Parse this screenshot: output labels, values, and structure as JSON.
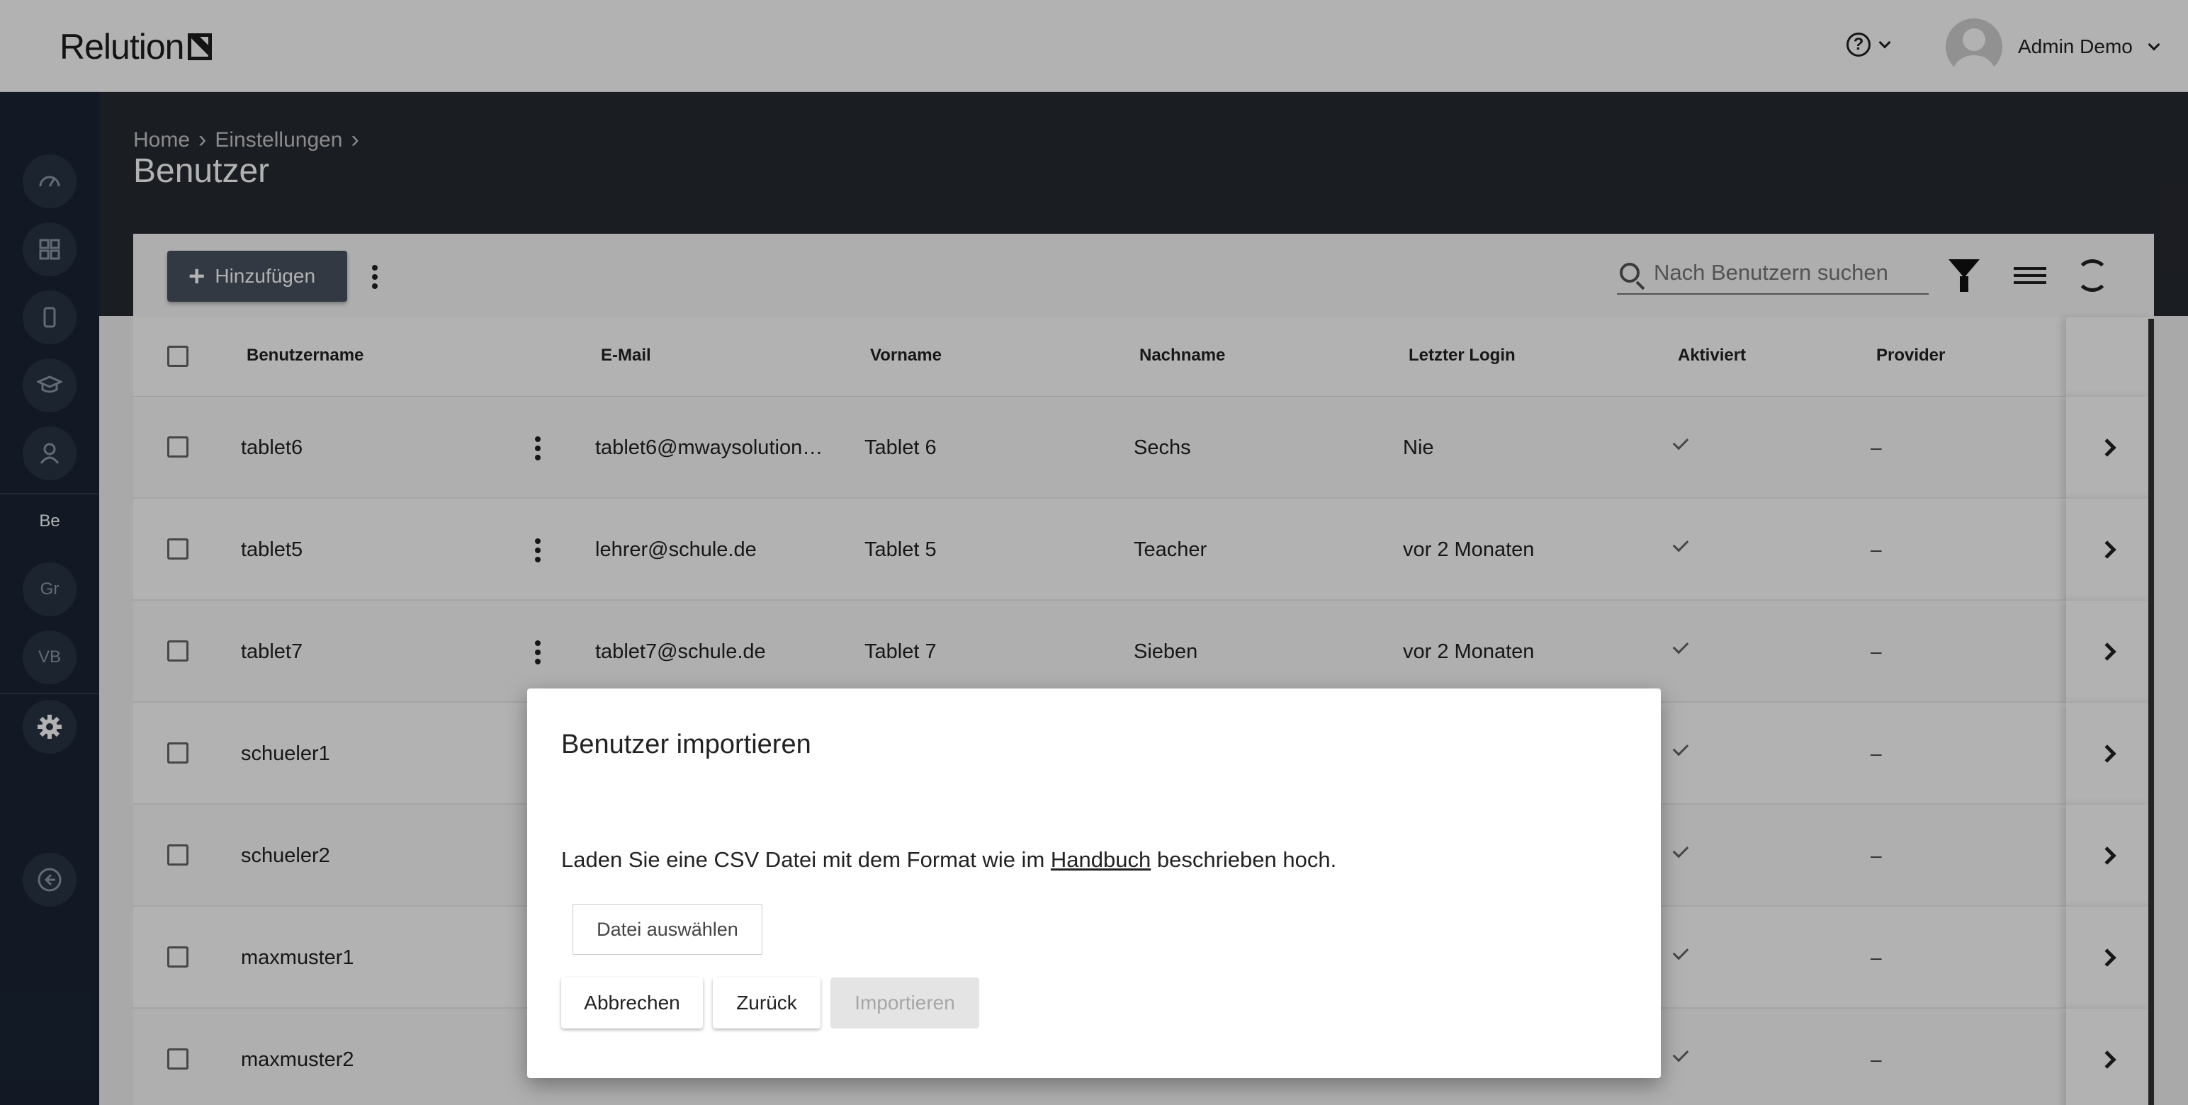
{
  "app": {
    "logo_text": "Relution"
  },
  "header": {
    "user_name": "Admin Demo"
  },
  "sidebar": {
    "items": [
      {
        "icon": "dashboard-icon"
      },
      {
        "icon": "apps-grid-icon"
      },
      {
        "icon": "device-icon"
      },
      {
        "icon": "education-icon"
      },
      {
        "icon": "user-icon"
      },
      {
        "label": "Be"
      },
      {
        "label": "Gr"
      },
      {
        "label": "VB"
      },
      {
        "icon": "gear-icon"
      },
      {
        "icon": "back-icon"
      }
    ]
  },
  "breadcrumb": {
    "home": "Home",
    "settings": "Einstellungen"
  },
  "page": {
    "title": "Benutzer"
  },
  "toolbar": {
    "add_label": "Hinzufügen",
    "search_placeholder": "Nach Benutzern suchen"
  },
  "table": {
    "columns": {
      "username": "Benutzername",
      "email": "E-Mail",
      "firstname": "Vorname",
      "lastname": "Nachname",
      "last_login": "Letzter Login",
      "activated": "Aktiviert",
      "provider": "Provider"
    },
    "rows": [
      {
        "username": "tablet6",
        "email": "tablet6@mwaysolution…",
        "firstname": "Tablet 6",
        "lastname": "Sechs",
        "last_login": "Nie",
        "provider": "–"
      },
      {
        "username": "tablet5",
        "email": "lehrer@schule.de",
        "firstname": "Tablet 5",
        "lastname": "Teacher",
        "last_login": "vor 2 Monaten",
        "provider": "–"
      },
      {
        "username": "tablet7",
        "email": "tablet7@schule.de",
        "firstname": "Tablet 7",
        "lastname": "Sieben",
        "last_login": "vor 2 Monaten",
        "provider": "–"
      },
      {
        "username": "schueler1",
        "provider": "–"
      },
      {
        "username": "schueler2",
        "provider": "–"
      },
      {
        "username": "maxmuster1",
        "provider": "–"
      },
      {
        "username": "maxmuster2",
        "provider": "–"
      }
    ]
  },
  "modal": {
    "title": "Benutzer importieren",
    "text_before": "Laden Sie eine CSV Datei mit dem Format wie im ",
    "link": "Handbuch",
    "text_after": " beschrieben hoch.",
    "file_button": "Datei auswählen",
    "cancel": "Abbrechen",
    "back": "Zurück",
    "import": "Importieren"
  }
}
